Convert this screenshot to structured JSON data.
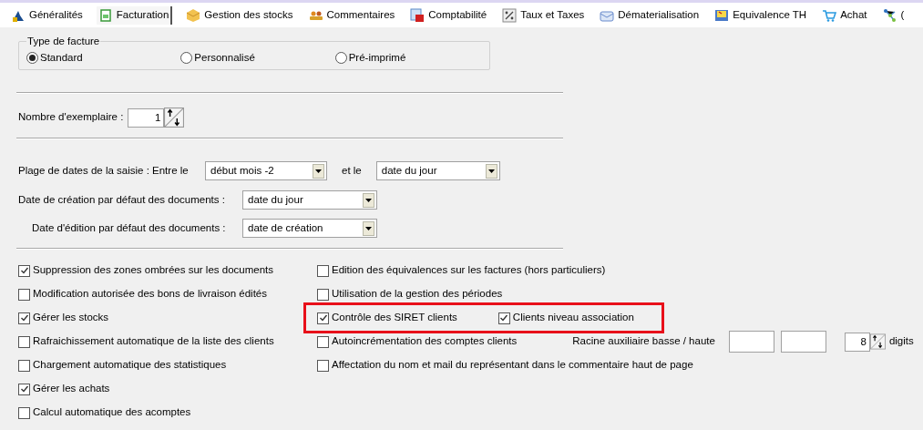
{
  "tabs": [
    {
      "label": "Généralités",
      "selected": false
    },
    {
      "label": "Facturation",
      "selected": true
    },
    {
      "label": "Gestion des stocks",
      "selected": false
    },
    {
      "label": "Commentaires",
      "selected": false
    },
    {
      "label": "Comptabilité",
      "selected": false
    },
    {
      "label": "Taux et Taxes",
      "selected": false
    },
    {
      "label": "Dématerialisation",
      "selected": false
    },
    {
      "label": "Equivalence TH",
      "selected": false
    },
    {
      "label": "Achat",
      "selected": false
    },
    {
      "label": "(",
      "selected": false
    }
  ],
  "invoice_type": {
    "title": "Type de facture",
    "options": [
      {
        "label": "Standard",
        "selected": true
      },
      {
        "label": "Personnalisé",
        "selected": false
      },
      {
        "label": "Pré-imprimé",
        "selected": false
      }
    ]
  },
  "copies": {
    "label": "Nombre d'exemplaire :",
    "value": "1"
  },
  "date_range": {
    "label": "Plage de dates de la saisie : Entre le",
    "from": "début mois -2",
    "joiner": "et le",
    "to": "date du jour"
  },
  "creation_default": {
    "label": "Date de création par défaut des documents :",
    "value": "date du jour"
  },
  "edit_default": {
    "label": "Date d'édition par défaut des documents :",
    "value": "date de création"
  },
  "options_left": [
    {
      "label": "Suppression des zones ombrées sur les documents",
      "checked": true
    },
    {
      "label": "Modification autorisée des bons de livraison édités",
      "checked": false
    },
    {
      "label": "Gérer les stocks",
      "checked": true
    },
    {
      "label": "Rafraichissement automatique de la liste des clients",
      "checked": false
    },
    {
      "label": "Chargement automatique des statistiques",
      "checked": false
    },
    {
      "label": "Gérer les achats",
      "checked": true
    },
    {
      "label": "Calcul automatique des acomptes",
      "checked": false
    }
  ],
  "options_right": [
    {
      "highlighted": false,
      "items": [
        {
          "kind": "checkbox",
          "label": "Edition des équivalences sur les factures (hors particuliers)",
          "checked": false
        }
      ]
    },
    {
      "highlighted": false,
      "items": [
        {
          "kind": "checkbox",
          "label": "Utilisation de la gestion des périodes",
          "checked": false
        }
      ]
    },
    {
      "highlighted": true,
      "items": [
        {
          "kind": "checkbox",
          "label": "Contrôle des SIRET clients",
          "checked": true
        },
        {
          "kind": "checkbox",
          "label": "Clients niveau association",
          "checked": true
        }
      ]
    },
    {
      "highlighted": false,
      "items": [
        {
          "kind": "checkbox",
          "label": "Autoincrémentation des comptes clients",
          "checked": false
        },
        {
          "kind": "root_fields",
          "label": "Racine auxiliaire basse / haute",
          "value": "8",
          "unit": "digits"
        }
      ]
    },
    {
      "highlighted": false,
      "items": [
        {
          "kind": "checkbox",
          "label": "Affectation du nom et mail du représentant dans le commentaire haut de page",
          "checked": false
        }
      ]
    }
  ]
}
